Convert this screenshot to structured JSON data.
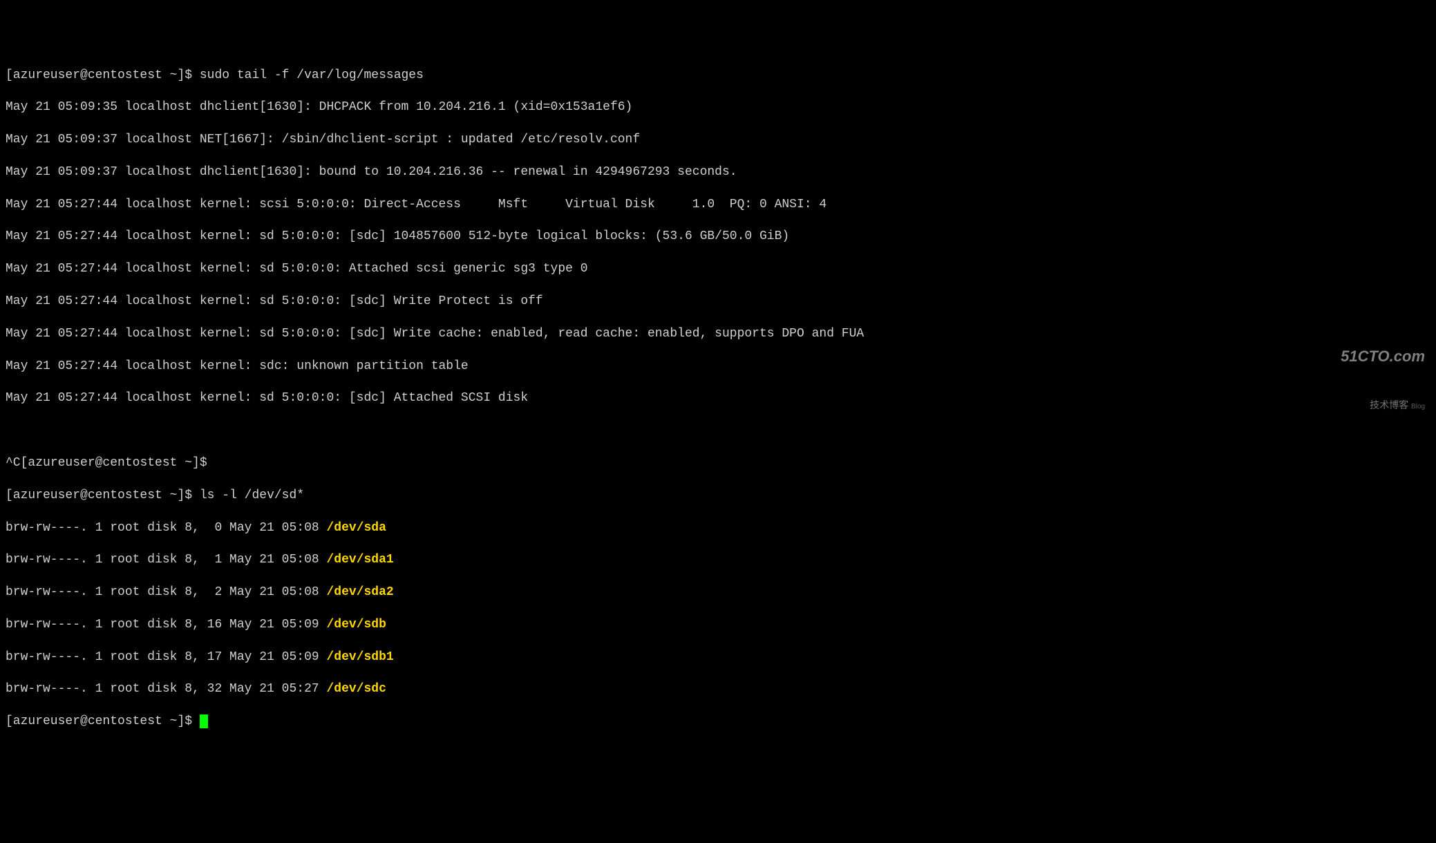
{
  "terminal": {
    "prompt1_user_host": "[azureuser@centostest ~]$",
    "command1": "sudo tail -f /var/log/messages",
    "log_lines": [
      "May 21 05:09:35 localhost dhclient[1630]: DHCPACK from 10.204.216.1 (xid=0x153a1ef6)",
      "May 21 05:09:37 localhost NET[1667]: /sbin/dhclient-script : updated /etc/resolv.conf",
      "May 21 05:09:37 localhost dhclient[1630]: bound to 10.204.216.36 -- renewal in 4294967293 seconds.",
      "May 21 05:27:44 localhost kernel: scsi 5:0:0:0: Direct-Access     Msft     Virtual Disk     1.0  PQ: 0 ANSI: 4",
      "May 21 05:27:44 localhost kernel: sd 5:0:0:0: [sdc] 104857600 512-byte logical blocks: (53.6 GB/50.0 GiB)",
      "May 21 05:27:44 localhost kernel: sd 5:0:0:0: Attached scsi generic sg3 type 0",
      "May 21 05:27:44 localhost kernel: sd 5:0:0:0: [sdc] Write Protect is off",
      "May 21 05:27:44 localhost kernel: sd 5:0:0:0: [sdc] Write cache: enabled, read cache: enabled, supports DPO and FUA",
      "May 21 05:27:44 localhost kernel: sdc: unknown partition table",
      "May 21 05:27:44 localhost kernel: sd 5:0:0:0: [sdc] Attached SCSI disk"
    ],
    "interrupt": "^C",
    "prompt2_user_host": "[azureuser@centostest ~]$",
    "command2": "ls -l /dev/sd*",
    "ls_rows": [
      {
        "perms": "brw-rw----. 1 root disk 8,  0 May 21 05:08 ",
        "dev": "/dev/sda"
      },
      {
        "perms": "brw-rw----. 1 root disk 8,  1 May 21 05:08 ",
        "dev": "/dev/sda1"
      },
      {
        "perms": "brw-rw----. 1 root disk 8,  2 May 21 05:08 ",
        "dev": "/dev/sda2"
      },
      {
        "perms": "brw-rw----. 1 root disk 8, 16 May 21 05:09 ",
        "dev": "/dev/sdb"
      },
      {
        "perms": "brw-rw----. 1 root disk 8, 17 May 21 05:09 ",
        "dev": "/dev/sdb1"
      },
      {
        "perms": "brw-rw----. 1 root disk 8, 32 May 21 05:27 ",
        "dev": "/dev/sdc"
      }
    ],
    "prompt3_user_host": "[azureuser@centostest ~]$"
  },
  "watermark": {
    "line1": "51CTO.com",
    "line2": "技术博客",
    "blog": "Blog"
  }
}
